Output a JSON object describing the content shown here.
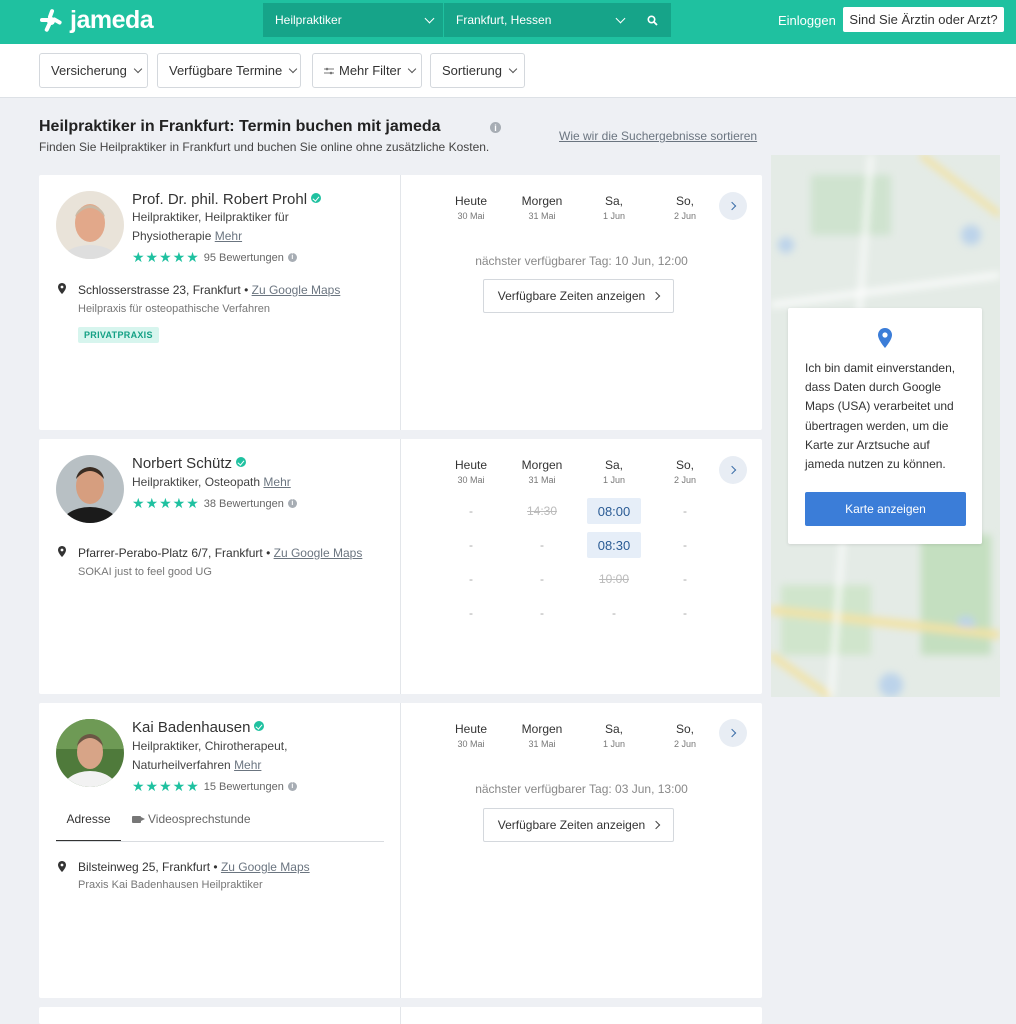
{
  "header": {
    "logo": "jameda",
    "specialty": "Heilpraktiker",
    "location": "Frankfurt, Hessen",
    "login": "Einloggen",
    "doctor_cta": "Sind Sie Ärztin oder Arzt?",
    "brand_color": "#1fc1a0"
  },
  "filters": [
    "Versicherung",
    "Verfügbare Termine",
    "Mehr Filter",
    "Sortierung"
  ],
  "page": {
    "title": "Heilpraktiker in Frankfurt: Termin buchen mit jameda",
    "subtitle": "Finden Sie Heilpraktiker in Frankfurt und buchen Sie online ohne zusätzliche Kosten.",
    "sort_link": "Wie wir die Suchergebnisse sortieren"
  },
  "days": [
    {
      "name": "Heute",
      "date": "30 Mai"
    },
    {
      "name": "Morgen",
      "date": "31 Mai"
    },
    {
      "name": "Sa,",
      "date": "1 Jun"
    },
    {
      "name": "So,",
      "date": "2 Jun"
    }
  ],
  "doctors": [
    {
      "name": "Prof. Dr. phil. Robert Prohl",
      "spec1": "Heilpraktiker, Heilpraktiker für",
      "spec2": "Physiotherapie",
      "more": "Mehr",
      "stars": "★★★★★",
      "reviews": "95 Bewertungen",
      "address": "Schlosserstrasse 23, Frankfurt",
      "maps": "Zu Google Maps",
      "practice": "Heilpraxis für osteopathische Verfahren",
      "badge": "PRIVATPRAXIS",
      "next_available": "nächster verfügbarer Tag: 10 Jun, 12:00",
      "show_times": "Verfügbare Zeiten anzeigen"
    },
    {
      "name": "Norbert Schütz",
      "spec1": "Heilpraktiker, Osteopath",
      "more": "Mehr",
      "stars": "★★★★★",
      "reviews": "38 Bewertungen",
      "address": "Pfarrer-Perabo-Platz 6/7, Frankfurt",
      "maps": "Zu Google Maps",
      "practice": "SOKAI just to feel good UG",
      "slots": [
        [
          "-",
          "14:30",
          "08:00",
          "-"
        ],
        [
          "-",
          "-",
          "08:30",
          "-"
        ],
        [
          "-",
          "-",
          "10:00",
          "-"
        ],
        [
          "-",
          "-",
          "-",
          "-"
        ]
      ]
    },
    {
      "name": "Kai Badenhausen",
      "spec1": "Heilpraktiker, Chirotherapeut,",
      "spec2": "Naturheilverfahren",
      "more": "Mehr",
      "stars": "★★★★★",
      "reviews": "15 Bewertungen",
      "tab_address": "Adresse",
      "tab_video": "Videosprechstunde",
      "address": "Bilsteinweg 25, Frankfurt",
      "maps": "Zu Google Maps",
      "practice": "Praxis Kai Badenhausen Heilpraktiker",
      "next_available": "nächster verfügbarer Tag: 03 Jun, 13:00",
      "show_times": "Verfügbare Zeiten anzeigen"
    }
  ],
  "map": {
    "consent_text": "Ich bin damit einverstanden, dass Daten durch Google Maps (USA) verarbeitet und übertragen werden, um die Karte zur Arztsuche auf jameda nutzen zu können.",
    "show_map": "Karte anzeigen"
  }
}
